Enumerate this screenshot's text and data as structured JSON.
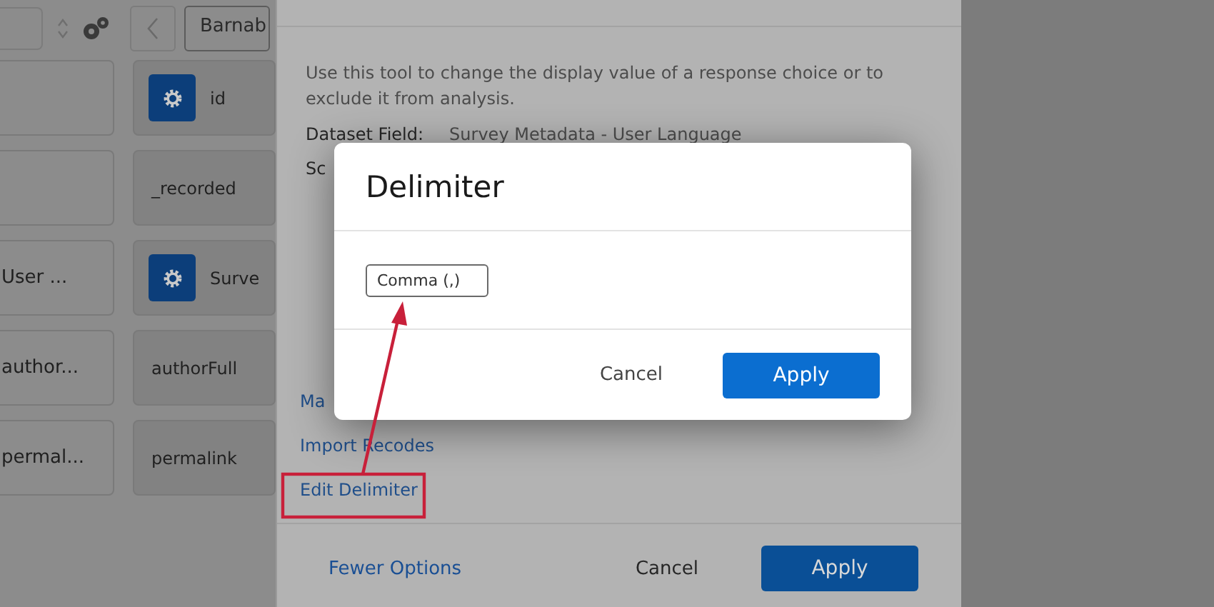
{
  "toolbar": {
    "field_value": "Barnab"
  },
  "left_cards": [
    {
      "kind": "blank"
    },
    {
      "kind": "blank"
    },
    {
      "kind": "text",
      "label": "User ..."
    },
    {
      "kind": "text",
      "label": "author..."
    },
    {
      "kind": "text",
      "label": "permal..."
    }
  ],
  "right_cards": [
    {
      "label": "id",
      "gear": true
    },
    {
      "label": "_recorded",
      "gear": false
    },
    {
      "label": "Surve",
      "gear": true
    },
    {
      "label": "authorFull",
      "gear": false
    },
    {
      "label": "permalink",
      "gear": false
    }
  ],
  "panel": {
    "description": "Use this tool to change the display value of a response choice or to exclude it from analysis.",
    "dataset_field": {
      "label": "Dataset Field:",
      "value": "Survey Metadata - User Language"
    },
    "second_label": "Sc",
    "links": [
      {
        "label": "Ma"
      },
      {
        "label": "Import Recodes"
      },
      {
        "label": "Edit Delimiter"
      }
    ],
    "footer": {
      "link": "Fewer Options",
      "cancel": "Cancel",
      "apply": "Apply"
    }
  },
  "dialog": {
    "title": "Delimiter",
    "delimiter": "Comma (,)",
    "cancel": "Cancel",
    "apply": "Apply"
  }
}
